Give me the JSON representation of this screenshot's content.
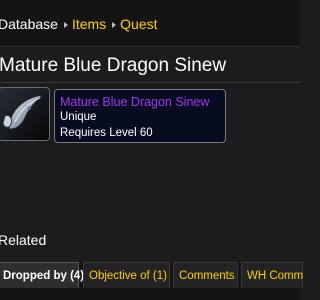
{
  "breadcrumb": {
    "items": [
      "Database",
      "Items",
      "Quest"
    ]
  },
  "item": {
    "title": "Mature Blue Dragon Sinew",
    "tooltip_name": "Mature Blue Dragon Sinew",
    "uniqueness": "Unique",
    "requirement": "Requires Level 60",
    "quality_color": "#a335ee",
    "icon": "blue-dragon-sinew-icon"
  },
  "related": {
    "heading": "Related",
    "tabs": [
      "Dropped by (4)",
      "Objective of (1)",
      "Comments",
      "WH Comm"
    ]
  },
  "colors": {
    "link": "#ffd100",
    "background": "#1c1c1c",
    "tooltip_bg": "#070c21"
  }
}
